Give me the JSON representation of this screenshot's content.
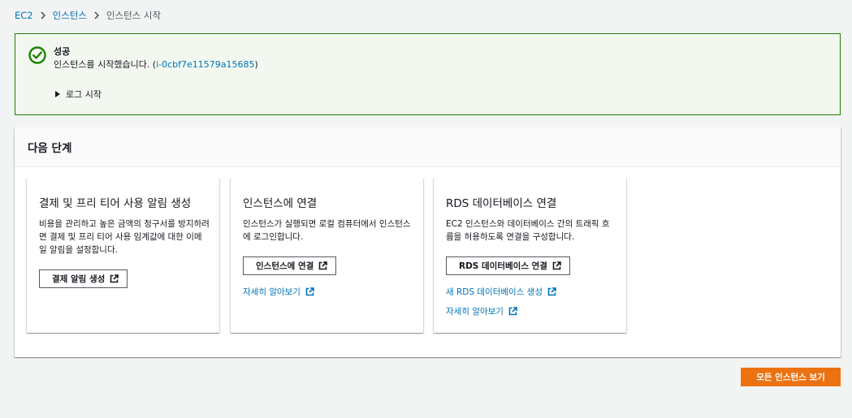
{
  "breadcrumb": {
    "items": [
      "EC2",
      "인스턴스",
      "인스턴스 시작"
    ]
  },
  "flash": {
    "status": "success",
    "title": "성공",
    "message_prefix": "인스턴스를 시작했습니다. (",
    "instance_id": "i-0cbf7e11579a15685",
    "message_suffix": ")",
    "expand_label": "로그 시작",
    "icon": "check-circle-icon",
    "color": "#1d8102"
  },
  "next_steps": {
    "title": "다음 단계",
    "cards": [
      {
        "title": "결제 및 프리 티어 사용 알림 생성",
        "description": "비용을 관리하고 높은 금액의 청구서를 방지하려면 결제 및 프리 티어 사용 임계값에 대한 이메일 알림을 설정합니다.",
        "button": "결제 알림 생성"
      },
      {
        "title": "인스턴스에 연결",
        "description": "인스턴스가 실행되면 로컬 컴퓨터에서 인스턴스에 로그인합니다.",
        "button": "인스턴스에 연결",
        "link": "자세히 알아보기"
      },
      {
        "title": "RDS 데이터베이스 연결",
        "description": "EC2 인스턴스와 데이터베이스 간의 트래픽 흐름을 허용하도록 연결을 구성합니다.",
        "button": "RDS 데이터베이스 연결",
        "links": [
          "새 RDS 데이터베이스 생성",
          "자세히 알아보기"
        ]
      }
    ]
  },
  "primary_button": {
    "label": "모든 인스턴스 보기",
    "color": "#ec7211"
  }
}
